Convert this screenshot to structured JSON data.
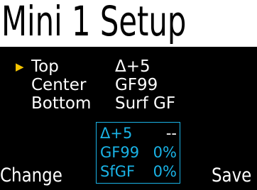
{
  "title": "Mini 1 Setup",
  "cursor_glyph": "▶",
  "settings": [
    {
      "label": "Top",
      "value": "Δ+5"
    },
    {
      "label": "Center",
      "value": "GF99"
    },
    {
      "label": "Bottom",
      "value": "Surf GF"
    }
  ],
  "readout": [
    {
      "name": "Δ+5",
      "value": "--"
    },
    {
      "name": "GF99",
      "value": "0%"
    },
    {
      "name": "SfGF",
      "value": "0%"
    }
  ],
  "softkeys": {
    "left": "Change",
    "right": "Save"
  },
  "colors": {
    "accent": "#1ab3e6",
    "cursor": "#f5c400",
    "text": "#ffffff",
    "background": "#000000"
  }
}
